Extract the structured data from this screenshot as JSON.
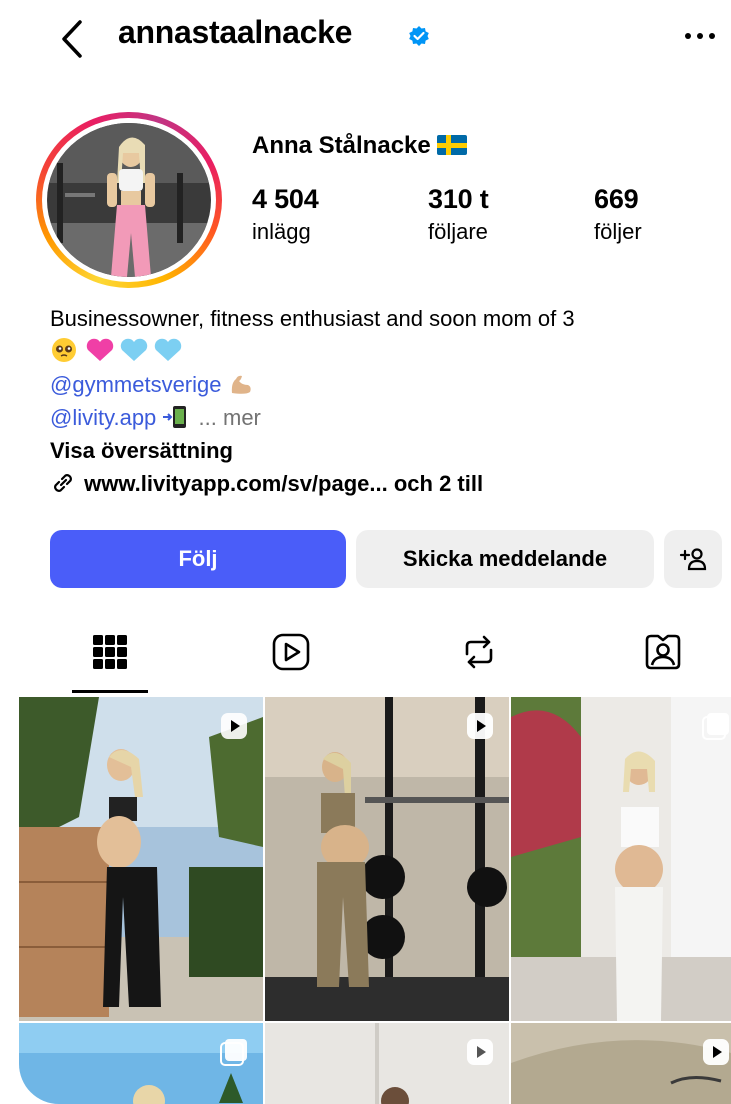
{
  "header": {
    "username": "annastaalnacke",
    "back_icon": "chevron-left-icon",
    "verified_icon": "verified-badge-icon",
    "more_icon": "more-horizontal-icon"
  },
  "profile": {
    "display_name": "Anna Stålnacke",
    "stats": [
      {
        "value": "4 504",
        "label": "inlägg"
      },
      {
        "value": "310 t",
        "label": "följare"
      },
      {
        "value": "669",
        "label": "följer"
      }
    ]
  },
  "bio": {
    "line1": "Businessowner, fitness enthusiast and soon mom of 3",
    "line2_emojis": "🥹💗🩵🩵",
    "mention1": "@gymmetsverige",
    "mention1_emoji": "💪🏼",
    "mention2": "@livity.app",
    "mention2_emoji": "📲",
    "more_label": "... mer",
    "translate_label": "Visa översättning",
    "link_icon": "link-icon",
    "website": "www.livityapp.com/sv/page...",
    "website_extra": "och 2 till"
  },
  "actions": {
    "follow_label": "Följ",
    "message_label": "Skicka meddelande",
    "add_person_icon": "add-person-icon"
  },
  "tabs": [
    {
      "icon": "grid-icon",
      "active": true
    },
    {
      "icon": "reels-icon",
      "active": false
    },
    {
      "icon": "reposts-icon",
      "active": false
    },
    {
      "icon": "tagged-icon",
      "active": false
    }
  ],
  "colors": {
    "follow_button": "#4a5df9",
    "link_blue": "#3b5bdb",
    "verified_blue": "#0095f6",
    "secondary_button": "#efefef"
  },
  "grid_posts": [
    {
      "badge": "reel-icon"
    },
    {
      "badge": "reel-icon"
    },
    {
      "badge": "carousel-icon"
    },
    {
      "badge": "carousel-icon"
    },
    {
      "badge": "reel-icon"
    },
    {
      "badge": "reel-icon"
    }
  ]
}
